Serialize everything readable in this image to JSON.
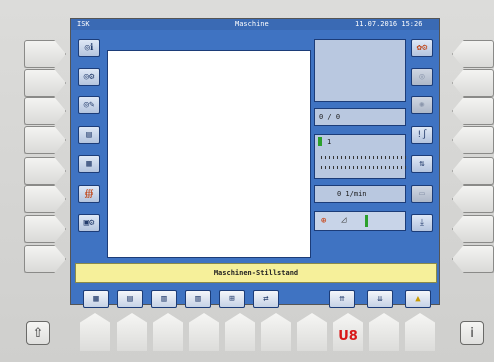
{
  "screen": {
    "title_left": "ISK",
    "title_center": "Maschine",
    "title_right": "11.07.2016 15:26"
  },
  "left_toolbar": {
    "icons": [
      "spool-info-icon",
      "spool-settings-icon",
      "spool-tools-icon",
      "document-icon",
      "color-grid-icon",
      "counter-icon",
      "machine-config-icon"
    ]
  },
  "right_toolbar": {
    "icons": [
      "flower-settings-icon",
      "spool-disabled-icon",
      "sun-disabled-icon",
      "thread-needle-icon",
      "direction-arrows-icon",
      "dash-disabled-icon",
      "needle-down-icon"
    ]
  },
  "panels": {
    "counter": "0 / 0",
    "step_value": "1",
    "speed": "0 1/min"
  },
  "status": {
    "message": "Maschinen-Stillstand"
  },
  "bottom_toolbar": {
    "icons": [
      "pattern-icon",
      "pattern-edit-icon",
      "grid-icon",
      "grid-alt-icon",
      "frame-icon",
      "transfer-icon",
      "needle-up-icon",
      "needle-down-arrows-icon",
      "arrow-up-icon"
    ]
  },
  "keys": {
    "u8_label": "U8",
    "home_label": "⇧",
    "info_label": "i"
  },
  "colors": {
    "screen_blue": "#3f73c2",
    "status_yellow": "#f6f09a",
    "u8_red": "#d81818"
  }
}
